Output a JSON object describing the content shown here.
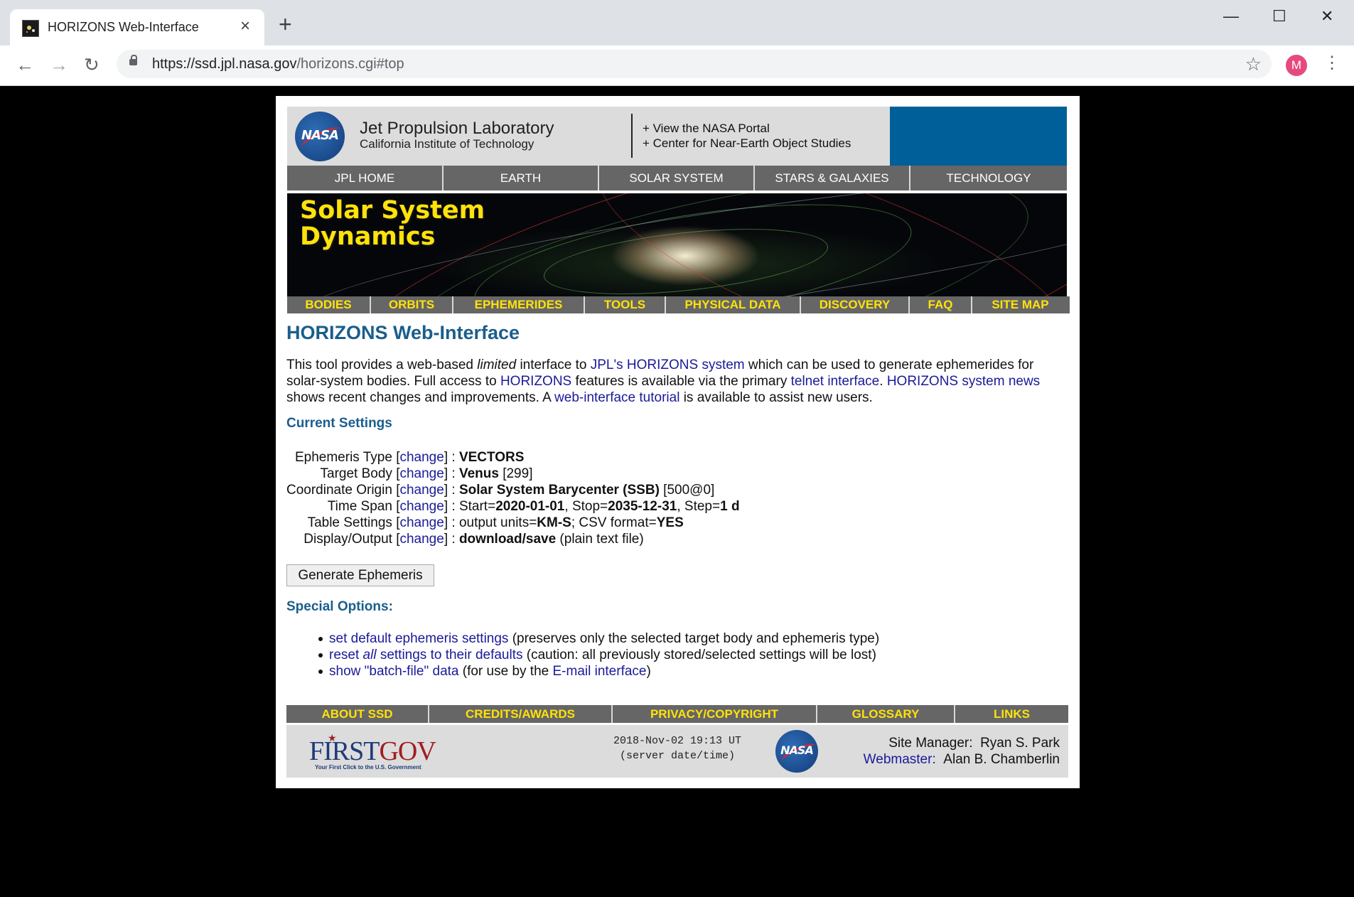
{
  "browser": {
    "tab_title": "HORIZONS Web-Interface",
    "close_tab_glyph": "×",
    "new_tab_glyph": "+",
    "url_host": "https://ssd.jpl.nasa.gov",
    "url_path": "/horizons.cgi#top",
    "profile_initial": "M",
    "back_glyph": "←",
    "forward_glyph": "→",
    "reload_glyph": "↻",
    "star_glyph": "☆",
    "menu_glyph": "⋮",
    "minimize_glyph": "—",
    "maximize_glyph": "☐",
    "close_window_glyph": "✕",
    "icons": [
      "back-icon",
      "forward-icon",
      "reload-icon",
      "lock-icon",
      "star-icon",
      "menu-icon"
    ]
  },
  "header": {
    "nasa_logo_text": "NASA",
    "title": "Jet Propulsion Laboratory",
    "subtitle": "California Institute of Technology",
    "links": [
      "+ View the NASA Portal",
      "+ Center for Near-Earth Object Studies"
    ]
  },
  "top_nav": [
    "JPL HOME",
    "EARTH",
    "SOLAR SYSTEM",
    "STARS & GALAXIES",
    "TECHNOLOGY"
  ],
  "banner": {
    "line1": "Solar System",
    "line2": "Dynamics"
  },
  "sub_nav": [
    "BODIES",
    "ORBITS",
    "EPHEMERIDES",
    "TOOLS",
    "PHYSICAL DATA",
    "DISCOVERY",
    "FAQ",
    "SITE MAP"
  ],
  "page_title": "HORIZONS Web-Interface",
  "intro": {
    "t1": "This tool provides a web-based ",
    "em": "limited",
    "t2": " interface to ",
    "l1": "JPL's HORIZONS system",
    "t3": " which can be used to generate ephemerides for solar-system bodies. Full access to ",
    "l2": "HORIZONS",
    "t4": " features is available via the primary ",
    "l3": "telnet interface",
    "t5": ". ",
    "l4": "HORIZONS system news",
    "t6": " shows recent changes and improvements. A ",
    "l5": "web-interface tutorial",
    "t7": " is available to assist new users."
  },
  "current_settings": {
    "heading": "Current Settings",
    "change_label": "change",
    "rows": [
      {
        "label": "Ephemeris Type",
        "b1": "VECTORS",
        "t1": ""
      },
      {
        "label": "Target Body",
        "b1": "Venus",
        "t1": " [299]"
      },
      {
        "label": "Coordinate Origin",
        "b1": "Solar System Barycenter (SSB)",
        "t1": " [500@0]"
      },
      {
        "label": "Time Span",
        "t0": "Start=",
        "b1": "2020-01-01",
        "t1": ", Stop=",
        "b2": "2035-12-31",
        "t2": ", Step=",
        "b3": "1 d"
      },
      {
        "label": "Table Settings",
        "t0": "output units=",
        "b1": "KM-S",
        "t1": "; CSV format=",
        "b2": "YES"
      },
      {
        "label": "Display/Output",
        "b1": "download/save",
        "t1": " (plain text file)"
      }
    ]
  },
  "generate_button": "Generate Ephemeris",
  "special_options": {
    "heading": "Special Options:",
    "items": [
      {
        "link": "set default ephemeris settings",
        "text": " (preserves only the selected target body and ephemeris type)"
      },
      {
        "link_a": "reset ",
        "link_em": "all",
        "link_b": " settings to their defaults",
        "text": " (caution: all previously stored/selected settings will be lost)"
      },
      {
        "link": "show \"batch-file\" data",
        "text": " (for use by the ",
        "link2": "E-mail interface",
        "text2": ")"
      }
    ]
  },
  "footer_nav": [
    "ABOUT SSD",
    "CREDITS/AWARDS",
    "PRIVACY/COPYRIGHT",
    "GLOSSARY",
    "LINKS"
  ],
  "footer": {
    "firstgov_first": "FIRST",
    "firstgov_gov": "GOV",
    "firstgov_tagline": "Your First Click to the U.S. Government",
    "server_time": "2018-Nov-02 19:13 UT",
    "server_note": "(server date/time)",
    "nasa_logo_text": "NASA",
    "manager_label": "Site Manager:",
    "manager_name": "Ryan S. Park",
    "webmaster_label": "Webmaster:",
    "webmaster_name": "Alan B. Chamberlin"
  },
  "colors": {
    "page_background": "#000000",
    "nav_gray": "#666666",
    "nav_yellow": "#ffe20a",
    "heading_blue": "#1a5e8c",
    "link_blue": "#1a1a99",
    "header_blue_block": "#005f99",
    "profile_pink": "#e64a7d"
  }
}
